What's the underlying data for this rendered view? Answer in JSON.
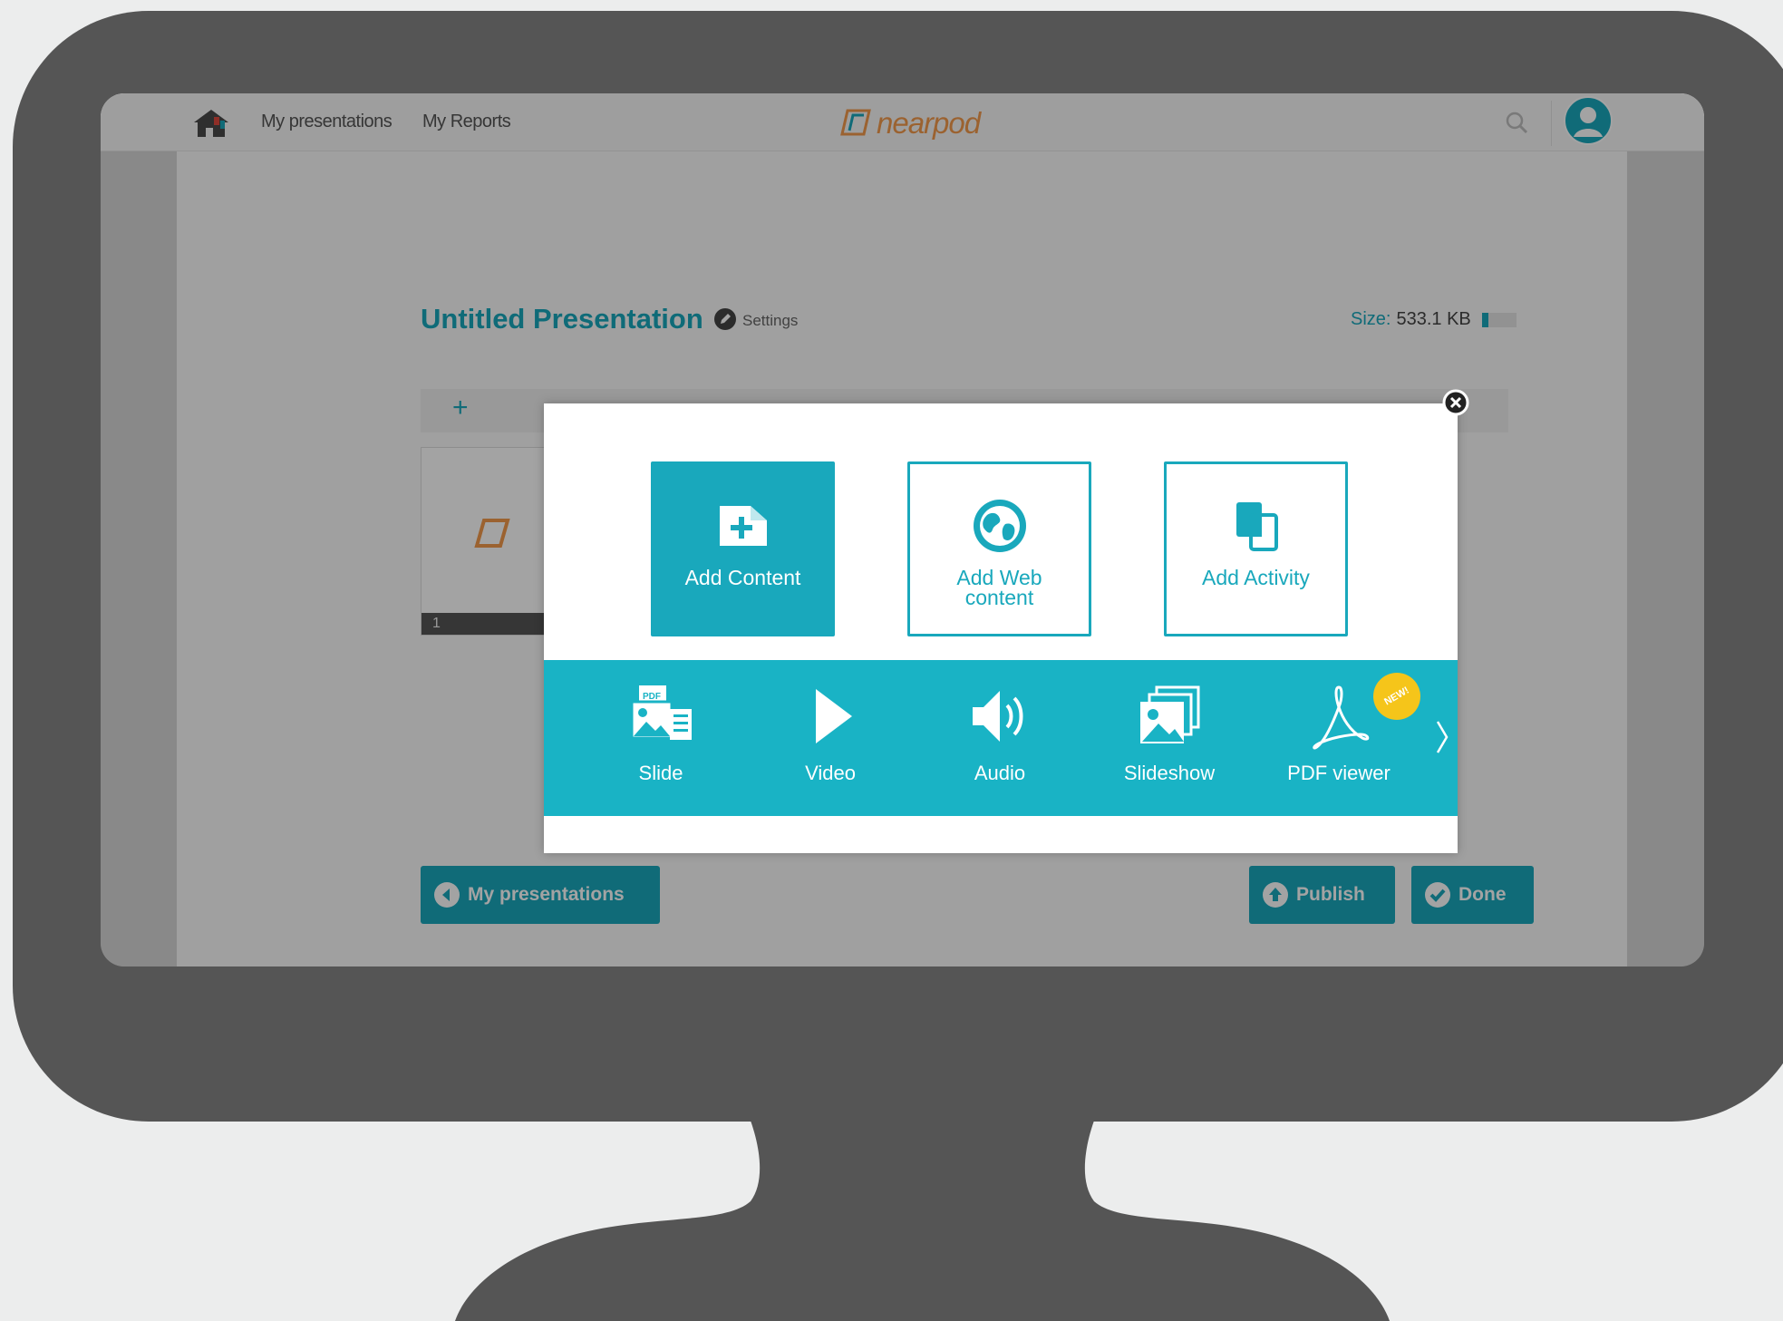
{
  "header": {
    "nav": [
      "My presentations",
      "My Reports"
    ],
    "logo_text": "nearpod"
  },
  "presentation": {
    "title": "Untitled Presentation",
    "settings_label": "Settings",
    "size_label": "Size:",
    "size_value": "533.1 KB",
    "size_fraction": 0.2,
    "slide_number": "1"
  },
  "buttons": {
    "my_presentations": "My presentations",
    "publish": "Publish",
    "done": "Done"
  },
  "modal": {
    "cards": [
      {
        "label": "Add Content",
        "icon": "add-file-icon"
      },
      {
        "label": "Add Web content",
        "icon": "globe-icon"
      },
      {
        "label": "Add Activity",
        "icon": "activity-icon"
      }
    ],
    "tools": [
      {
        "label": "Slide",
        "icon": "slide-icon"
      },
      {
        "label": "Video",
        "icon": "play-icon"
      },
      {
        "label": "Audio",
        "icon": "speaker-icon"
      },
      {
        "label": "Slideshow",
        "icon": "slideshow-icon"
      },
      {
        "label": "PDF viewer",
        "icon": "pdf-icon"
      }
    ],
    "badge": "NEW!"
  },
  "colors": {
    "accent": "#19a8bc",
    "band": "#19b3c5",
    "monitor": "#555555",
    "badge": "#f5c51a",
    "logo": "#f29a4b"
  }
}
